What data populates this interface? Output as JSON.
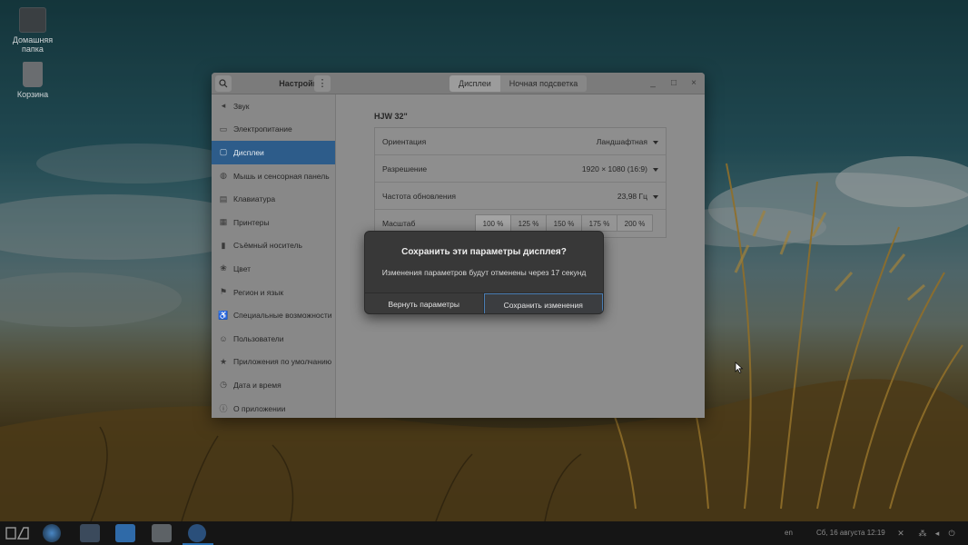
{
  "desktop": {
    "icons": [
      {
        "name": "home-folder",
        "label": "Домашняя папка"
      },
      {
        "name": "trash",
        "label": "Корзина"
      }
    ]
  },
  "window": {
    "title": "Настройки",
    "tabs": [
      {
        "label": "Дисплеи",
        "active": true
      },
      {
        "label": "Ночная подсветка",
        "active": false
      }
    ],
    "controls": {
      "minimize": "_",
      "maximize": "□",
      "close": "×"
    }
  },
  "sidebar": {
    "items": [
      {
        "label": "Звук",
        "icon": "speaker-icon",
        "active": false
      },
      {
        "label": "Электропитание",
        "icon": "battery-icon",
        "active": false
      },
      {
        "label": "Дисплеи",
        "icon": "display-icon",
        "active": true
      },
      {
        "label": "Мышь и сенсорная панель",
        "icon": "mouse-icon",
        "active": false
      },
      {
        "label": "Клавиатура",
        "icon": "keyboard-icon",
        "active": false
      },
      {
        "label": "Принтеры",
        "icon": "printer-icon",
        "active": false
      },
      {
        "label": "Съёмный носитель",
        "icon": "removable-media-icon",
        "active": false
      },
      {
        "label": "Цвет",
        "icon": "color-icon",
        "active": false
      },
      {
        "label": "Регион и язык",
        "icon": "region-icon",
        "active": false
      },
      {
        "label": "Специальные возможности",
        "icon": "accessibility-icon",
        "active": false
      },
      {
        "label": "Пользователи",
        "icon": "users-icon",
        "active": false
      },
      {
        "label": "Приложения по умолчанию",
        "icon": "star-icon",
        "active": false
      },
      {
        "label": "Дата и время",
        "icon": "clock-icon",
        "active": false
      },
      {
        "label": "О приложении",
        "icon": "info-icon",
        "active": false
      }
    ]
  },
  "display": {
    "monitor_name": "HJW 32\"",
    "orientation": {
      "label": "Ориентация",
      "value": "Ландшафтная"
    },
    "resolution": {
      "label": "Разрешение",
      "value": "1920 × 1080 (16:9)"
    },
    "refresh_rate": {
      "label": "Частота обновления",
      "value": "23,98 Гц"
    },
    "scale": {
      "label": "Масштаб",
      "options": [
        "100 %",
        "125 %",
        "150 %",
        "175 %",
        "200 %"
      ],
      "selected": "100 %"
    }
  },
  "dialog": {
    "title": "Сохранить эти параметры дисплея?",
    "message": "Изменения параметров будут отменены через 17 секунд",
    "revert_label": "Вернуть параметры",
    "keep_label": "Сохранить изменения"
  },
  "taskbar": {
    "language": "en",
    "datetime": "Сб, 16 августа  12:19",
    "colors": {
      "accent": "#2b6fb0"
    }
  }
}
